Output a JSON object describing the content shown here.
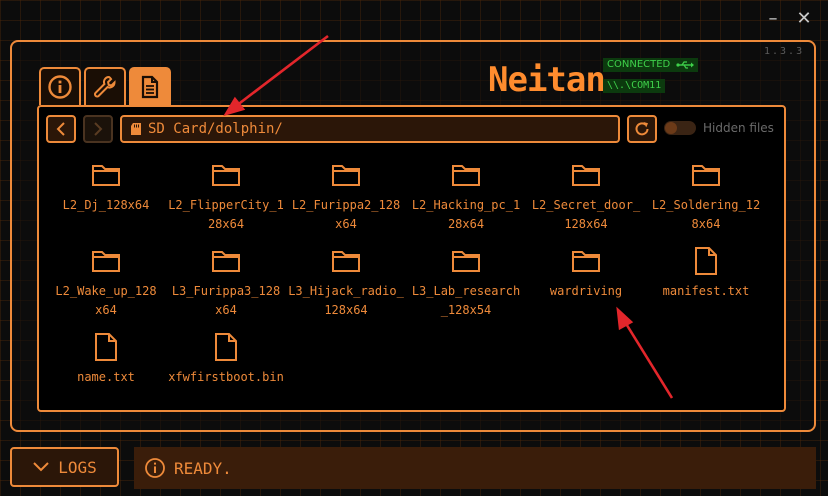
{
  "window": {
    "version": "1.3.3",
    "minimize_icon": "minimize-icon",
    "close_icon": "close-icon"
  },
  "tabs": [
    {
      "name": "info",
      "icon": "info-icon"
    },
    {
      "name": "tools",
      "icon": "wrench-icon"
    },
    {
      "name": "files",
      "icon": "document-icon",
      "active": true
    }
  ],
  "brand": {
    "logo": "Neitan",
    "status": "CONNECTED",
    "status_icon": "usb-icon",
    "port": "\\\\.\\COM11"
  },
  "file_browser": {
    "path": "SD Card/dolphin/",
    "path_icon": "sd-card-icon",
    "hidden_files_label": "Hidden files",
    "hidden_files_enabled": false,
    "items": [
      {
        "type": "folder",
        "label": "L2_Dj_128x64"
      },
      {
        "type": "folder",
        "label": "L2_FlipperCity_1\n28x64"
      },
      {
        "type": "folder",
        "label": "L2_Furippa2_128\nx64"
      },
      {
        "type": "folder",
        "label": "L2_Hacking_pc_1\n28x64"
      },
      {
        "type": "folder",
        "label": "L2_Secret_door_\n128x64"
      },
      {
        "type": "folder",
        "label": "L2_Soldering_12\n8x64"
      },
      {
        "type": "folder",
        "label": "L2_Wake_up_128\nx64"
      },
      {
        "type": "folder",
        "label": "L3_Furippa3_128\nx64"
      },
      {
        "type": "folder",
        "label": "L3_Hijack_radio_\n128x64"
      },
      {
        "type": "folder",
        "label": "L3_Lab_research\n_128x54"
      },
      {
        "type": "folder",
        "label": "wardriving"
      },
      {
        "type": "file",
        "label": "manifest.txt"
      },
      {
        "type": "file",
        "label": "name.txt"
      },
      {
        "type": "file",
        "label": "xfwfirstboot.bin"
      }
    ]
  },
  "footer": {
    "logs_label": "LOGS",
    "status_text": "READY."
  },
  "colors": {
    "accent": "#ee8a3a",
    "annotation": "#e3262b",
    "status_green": "#3ed04a"
  }
}
